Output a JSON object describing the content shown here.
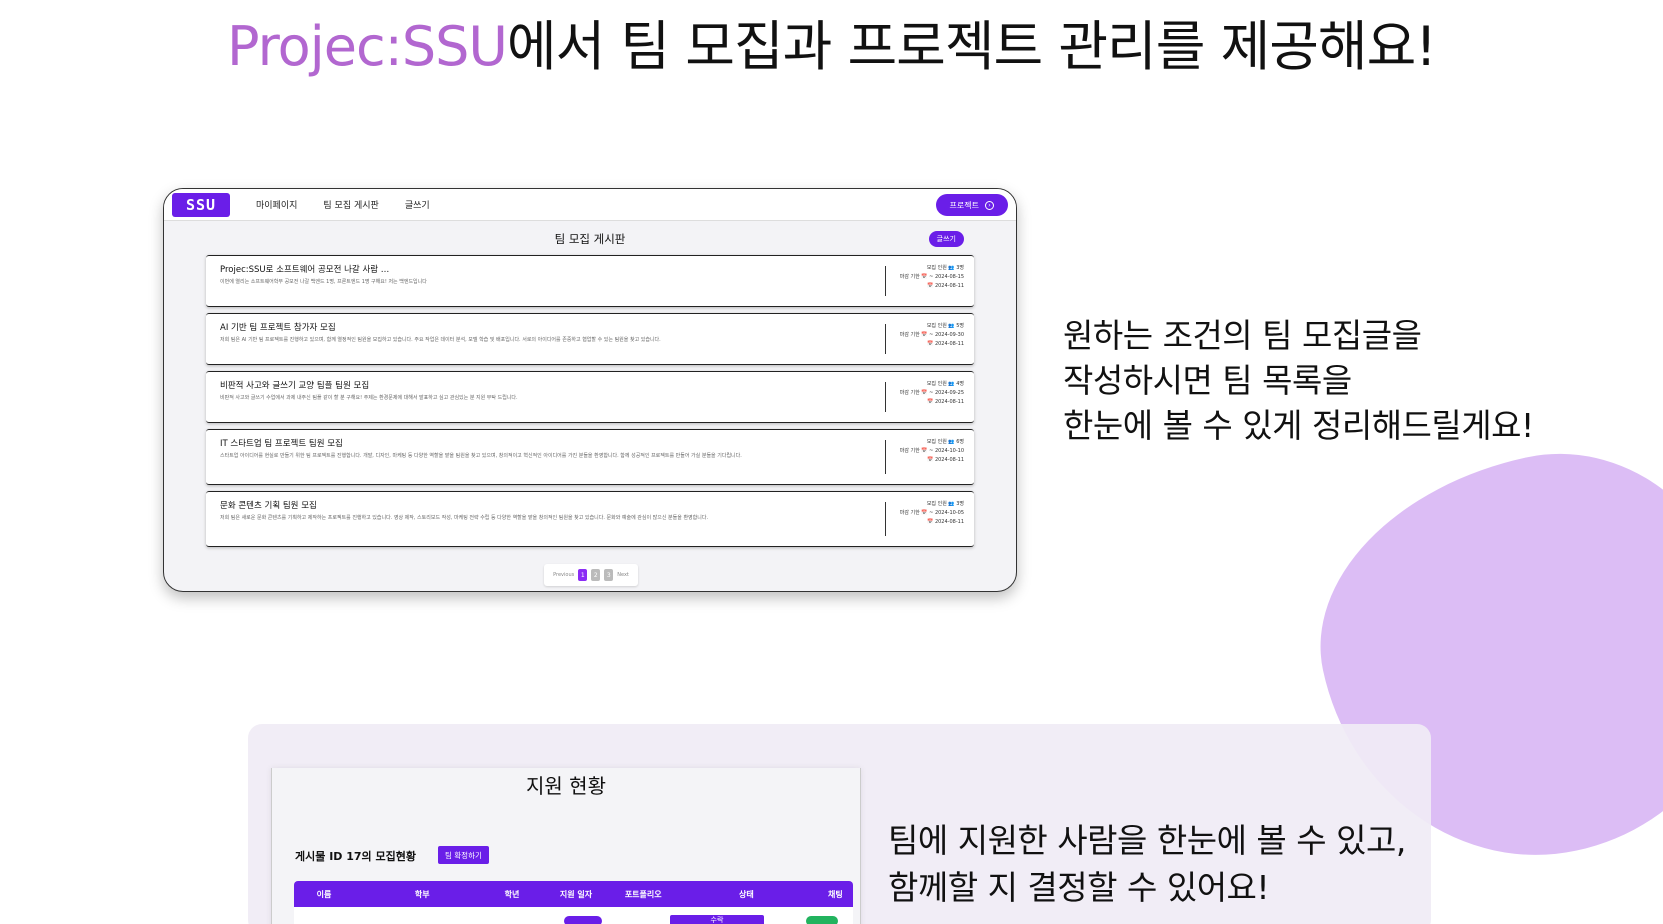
{
  "headline": {
    "brand": "Projec:SSU",
    "rest": "에서 팀 모집과 프로젝트 관리를 제공해요!"
  },
  "colors": {
    "brand_purple": "#6a1ee8",
    "accent_pink": "#b267d0",
    "blob": "#dcbdf5"
  },
  "board": {
    "logo": "SSU",
    "nav": [
      "마이페이지",
      "팀 모집 게시판",
      "글쓰기"
    ],
    "project_button": "프로젝트",
    "title": "팀 모집 게시판",
    "write_button": "글쓰기",
    "posts": [
      {
        "title": "Projec:SSU로 소프트웨어 공모전 나갈 사람 …",
        "desc": "이번에 열리는 소프트웨어학부 공모전 나갈 백엔드 1명, 프론트엔드 1명 구해요! 저는 백엔드입니다",
        "members": "모집 인원 👥 3명",
        "deadline": "마감 기한 📅 ~ 2024-08-15",
        "date": "📅 2024-08-11"
      },
      {
        "title": "AI 기반 팀 프로젝트 참가자 모집",
        "desc": "저희 팀은 AI 기반 팀 프로젝트를 진행하고 있으며, 함께 열정적인 팀원을 모집하고 있습니다. 주요 작업은 데이터 분석, 모델 학습 및 배포입니다. 서로의 아이디어를 존중하고 협업할 수 있는 팀원을 찾고 있습니다.",
        "members": "모집 인원 👥 5명",
        "deadline": "마감 기한 📅 ~ 2024-09-30",
        "date": "📅 2024-08-11"
      },
      {
        "title": "비판적 사고와 글쓰기 교양 팀플 팀원 모집",
        "desc": "비판적 사고와 글쓰기 수업에서 과제 내주신 팀플 같이 할 분 구해요! 주제는 환경문제에 대해서 발표하고 싶고 관심있는 분 지원 부탁 드립니다.",
        "members": "모집 인원 👥 4명",
        "deadline": "마감 기한 📅 ~ 2024-09-25",
        "date": "📅 2024-08-11"
      },
      {
        "title": "IT 스타트업 팀 프로젝트 팀원 모집",
        "desc": "스타트업 아이디어를 현실로 만들기 위한 팀 프로젝트를 진행합니다. 개발, 디자인, 마케팅 등 다양한 역할을 맡을 팀원을 찾고 있으며, 창의적이고 혁신적인 아이디어를 가진 분들을 환영합니다. 함께 성공적인 프로젝트를 만들어 가실 분들을 기다립니다.",
        "members": "모집 인원 👥 6명",
        "deadline": "마감 기한 📅 ~ 2024-10-10",
        "date": "📅 2024-08-11"
      },
      {
        "title": "문화 콘텐츠 기획 팀원 모집",
        "desc": "저희 팀은 새로운 문화 콘텐츠를 기획하고 제작하는 프로젝트를 진행하고 있습니다. 영상 제작, 스토리보드 작성, 마케팅 전략 수립 등 다양한 역할을 맡을 창의적인 팀원을 찾고 있습니다. 문화와 예술에 관심이 많으신 분들을 환영합니다.",
        "members": "모집 인원 👥 3명",
        "deadline": "마감 기한 📅 ~ 2024-10-05",
        "date": "📅 2024-08-11"
      }
    ],
    "pager": {
      "prev": "Previous",
      "pages": [
        "1",
        "2",
        "3"
      ],
      "next": "Next",
      "current": 1
    }
  },
  "right_text": [
    "원하는 조건의 팀 모집글을",
    "작성하시면 팀 목록을",
    "한눈에 볼 수 있게 정리해드릴게요!"
  ],
  "applicants": {
    "title": "지원 현황",
    "subtitle": "게시물 ID 17의 모집현황",
    "confirm_button": "팀 확정하기",
    "columns": [
      "이름",
      "학부",
      "학년",
      "지원 일자",
      "포트폴리오",
      "상태",
      "채팅"
    ],
    "status_label": "수락"
  },
  "bottom_text": [
    "팀에 지원한 사람을 한눈에 볼 수 있고,",
    "함께할 지 결정할 수 있어요!"
  ]
}
